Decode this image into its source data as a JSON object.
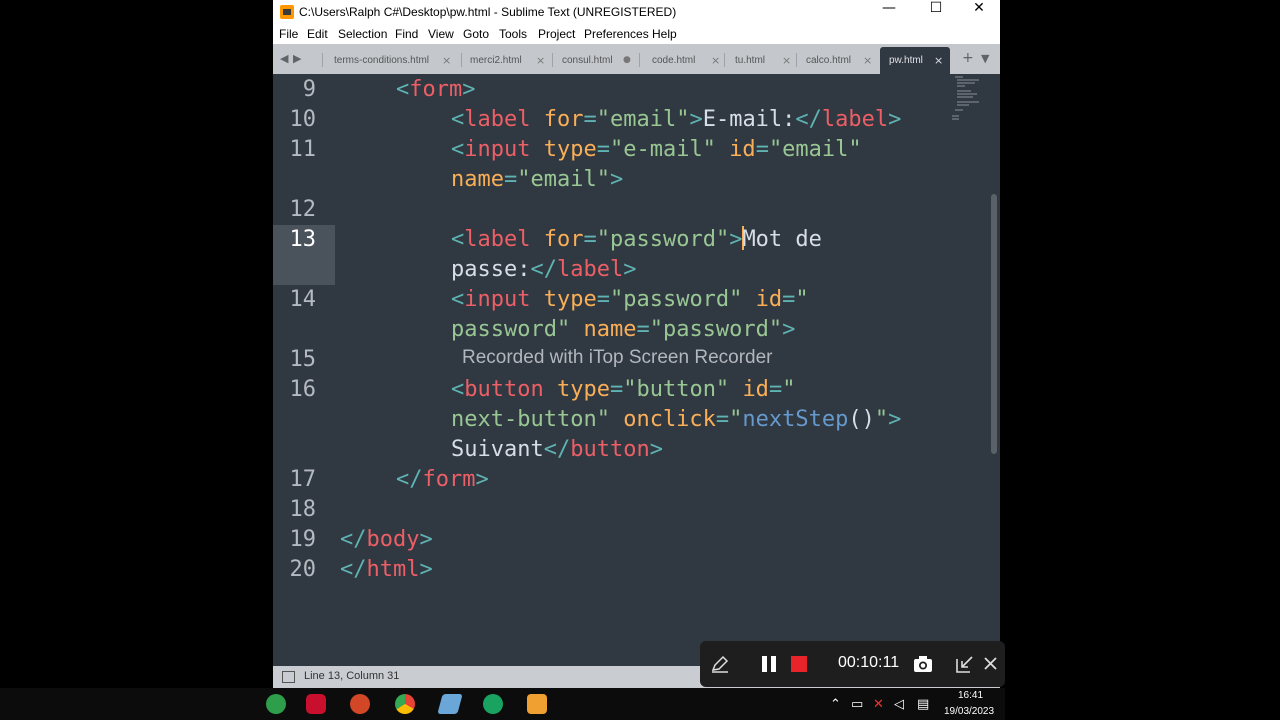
{
  "window": {
    "title": "C:\\Users\\Ralph C#\\Desktop\\pw.html - Sublime Text (UNREGISTERED)",
    "controls": {
      "minimize": "—",
      "maximize": "☐",
      "close": "✕"
    }
  },
  "menu": [
    "File",
    "Edit",
    "Selection",
    "Find",
    "View",
    "Goto",
    "Tools",
    "Project",
    "Preferences",
    "Help"
  ],
  "tabs": [
    {
      "label": "terms-conditions.html",
      "close": "×"
    },
    {
      "label": "merci2.html",
      "close": "×"
    },
    {
      "label": "consul.html",
      "close": "●"
    },
    {
      "label": "code.html",
      "close": "×"
    },
    {
      "label": "tu.html",
      "close": "×"
    },
    {
      "label": "calco.html",
      "close": "×"
    },
    {
      "label": "pw.html",
      "close": "×"
    }
  ],
  "tabbar_controls": {
    "back": "◀",
    "forward": "▶",
    "new_tab": "+",
    "dropdown": "▼"
  },
  "line_numbers": {
    "l9": "9",
    "l10": "10",
    "l11": "11",
    "l12": "12",
    "l13": "13",
    "l14": "14",
    "l15": "15",
    "l16": "16",
    "l17": "17",
    "l18": "18",
    "l19": "19",
    "l20": "20"
  },
  "code": {
    "r9": {
      "open": "<",
      "tag": "form",
      "close": ">"
    },
    "r10": {
      "open": "<",
      "tag": "label",
      "attr": "for",
      "eq": "=",
      "val": "\"email\"",
      "close": ">",
      "text": "E-mail:",
      "end_open": "</",
      "end_tag": "label",
      "end_close": ">"
    },
    "r11": {
      "open": "<",
      "tag": "input",
      "attr1": "type",
      "eq1": "=",
      "val1": "\"e-mail\"",
      "attr2": "id",
      "eq2": "=",
      "val2": "\"email\""
    },
    "r11b": {
      "attr": "name",
      "eq": "=",
      "val": "\"email\"",
      "close": ">"
    },
    "r13": {
      "open": "<",
      "tag": "label",
      "attr": "for",
      "eq": "=",
      "val": "\"password\"",
      "close": ">",
      "text": "Mot de"
    },
    "r13b": {
      "text": "passe:",
      "end_open": "</",
      "end_tag": "label",
      "end_close": ">"
    },
    "r14": {
      "open": "<",
      "tag": "input",
      "attr1": "type",
      "eq1": "=",
      "val1": "\"password\"",
      "attr2": "id",
      "eq2": "=",
      "val2": "\""
    },
    "r14b": {
      "val1": "password\"",
      "attr": "name",
      "eq": "=",
      "val2": "\"password\"",
      "close": ">"
    },
    "r16": {
      "open": "<",
      "tag": "button",
      "attr1": "type",
      "eq1": "=",
      "val1": "\"button\"",
      "attr2": "id",
      "eq2": "=",
      "val2": "\""
    },
    "r16b": {
      "val1": "next-button\"",
      "attr": "onclick",
      "eq": "=",
      "q1": "\"",
      "fn": "nextStep",
      "parens": "()",
      "q2": "\"",
      "close": ">"
    },
    "r16c": {
      "text": "Suivant",
      "end_open": "</",
      "end_tag": "button",
      "end_close": ">"
    },
    "r17": {
      "open": "</",
      "tag": "form",
      "close": ">"
    },
    "r19": {
      "open": "</",
      "tag": "body",
      "close": ">"
    },
    "r20": {
      "open": "</",
      "tag": "html",
      "close": ">"
    }
  },
  "watermark": "Recorded with iTop Screen Recorder",
  "status": {
    "position": "Line 13, Column 31"
  },
  "recorder": {
    "elapsed": "00:10:11"
  },
  "taskbar": {
    "time": "16:41",
    "date": "19/03/2023"
  },
  "colors": {
    "editor_bg": "#303841",
    "tag": "#ec5f66",
    "punct": "#5fb3b3",
    "attr": "#f9ae58",
    "string": "#99c794",
    "func": "#6699cc"
  }
}
